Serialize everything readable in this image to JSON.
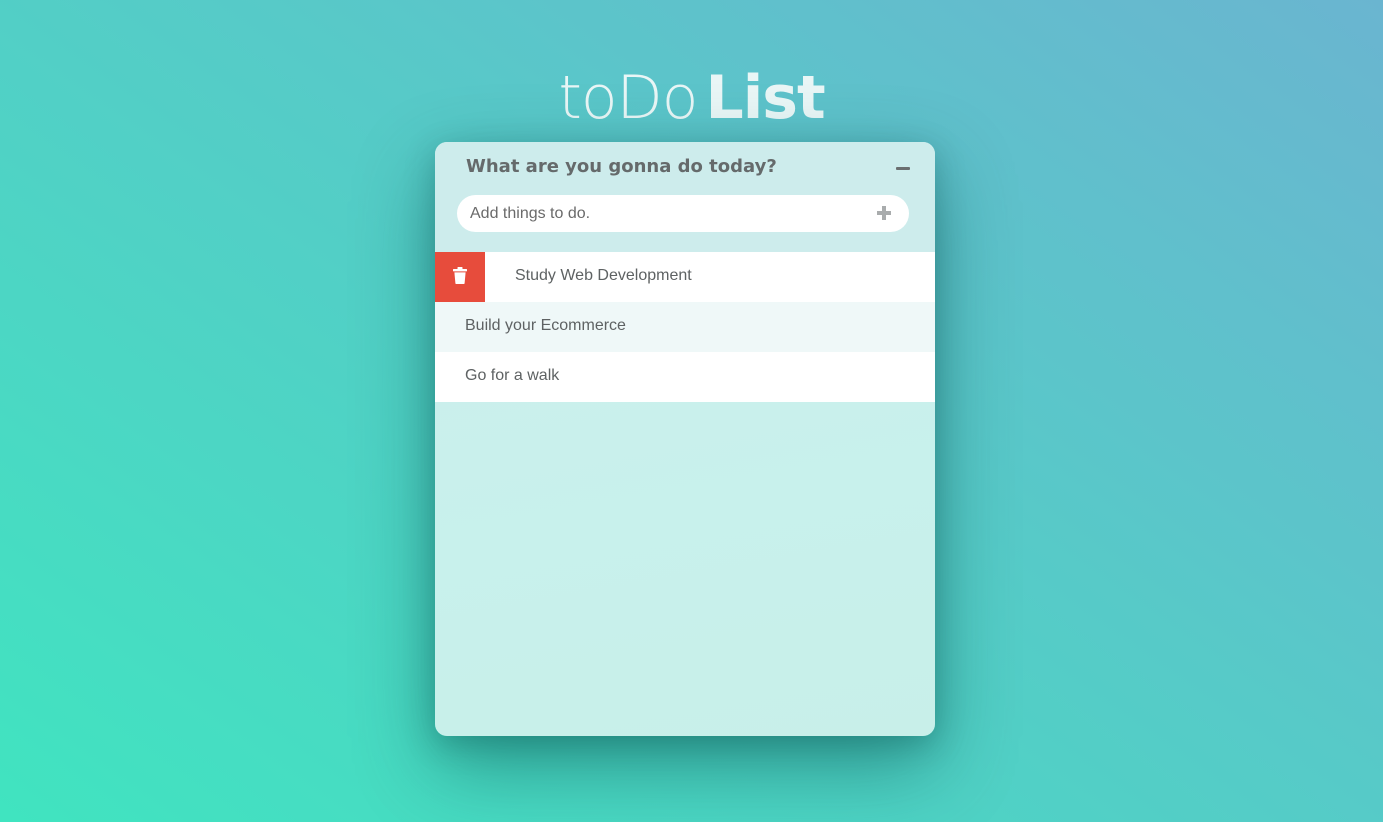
{
  "header": {
    "title_light": "toDo",
    "title_bold": "List"
  },
  "card": {
    "heading": "What are you gonna do today?",
    "minimize_icon": "minus-icon",
    "add_input": {
      "placeholder": "Add things to do.",
      "value": ""
    },
    "add_icon": "plus-icon"
  },
  "todos": [
    {
      "text": "Study Web Development",
      "hovered": true,
      "delete_icon": "trash-icon"
    },
    {
      "text": "Build your Ecommerce",
      "hovered": false
    },
    {
      "text": "Go for a walk",
      "hovered": false
    }
  ],
  "colors": {
    "background_start": "#40e4c0",
    "background_end": "#6ab5d0",
    "delete_red": "#e74c3c",
    "card": "#cdecec"
  }
}
